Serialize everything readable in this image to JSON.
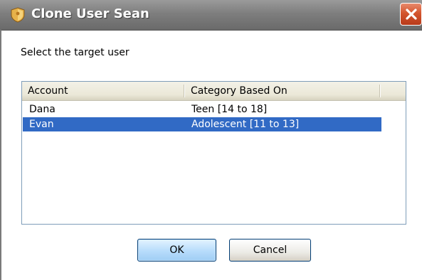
{
  "window": {
    "title": "Clone User Sean",
    "icon": "shield-icon",
    "close_icon": "close-icon"
  },
  "instruction": "Select the target user",
  "list": {
    "columns": [
      "Account",
      "Category Based On"
    ],
    "rows": [
      {
        "account": "Dana",
        "category": "Teen [14 to 18]",
        "selected": false
      },
      {
        "account": "Evan",
        "category": "Adolescent [11 to 13]",
        "selected": true
      }
    ]
  },
  "buttons": {
    "ok": "OK",
    "cancel": "Cancel"
  },
  "colors": {
    "selection": "#316ac5",
    "close_button": "#d4552e",
    "titlebar": "#7e7e7e"
  }
}
